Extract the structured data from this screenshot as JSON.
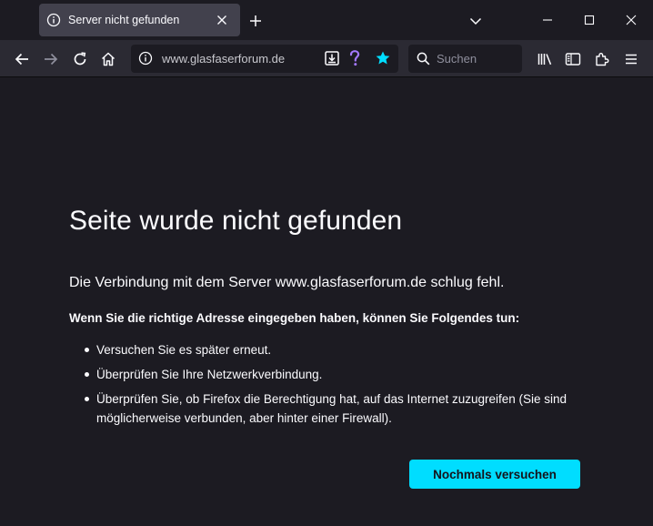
{
  "tab": {
    "title": "Server nicht gefunden",
    "icon": "info-icon"
  },
  "toolbar": {
    "url": "www.glasfaserforum.de",
    "search_placeholder": "Suchen",
    "accent_color": "#00ddff"
  },
  "error": {
    "title": "Seite wurde nicht gefunden",
    "description": "Die Verbindung mit dem Server www.glasfaserforum.de schlug fehl.",
    "subtitle": "Wenn Sie die richtige Adresse eingegeben haben, können Sie Folgendes tun:",
    "suggestions": [
      "Versuchen Sie es später erneut.",
      "Überprüfen Sie Ihre Netzwerkverbindung.",
      "Überprüfen Sie, ob Firefox die Berechtigung hat, auf das Internet zuzugreifen (Sie sind möglicherweise verbunden, aber hinter einer Firewall)."
    ],
    "retry_label": "Nochmals versuchen"
  }
}
